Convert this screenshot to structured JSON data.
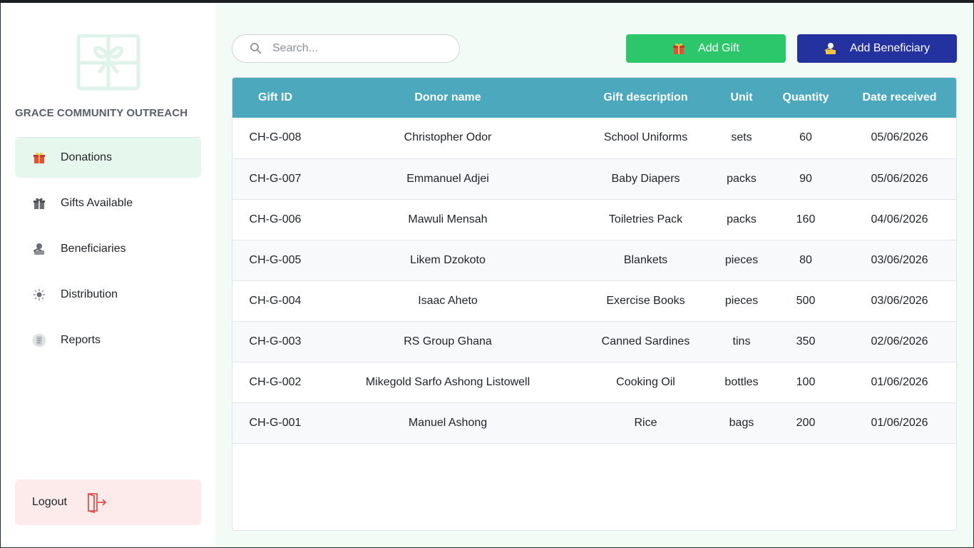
{
  "brand": {
    "name": "GRACE COMMUNITY OUTREACH",
    "logo_icon": "gift-box-logo-icon"
  },
  "sidebar": {
    "items": [
      {
        "label": "Donations",
        "icon": "gift-icon",
        "active": true
      },
      {
        "label": "Gifts Available",
        "icon": "gift-box-icon",
        "active": false
      },
      {
        "label": "Beneficiaries",
        "icon": "beneficiary-icon",
        "active": false
      },
      {
        "label": "Distribution",
        "icon": "distribution-icon",
        "active": false
      },
      {
        "label": "Reports",
        "icon": "report-icon",
        "active": false
      }
    ],
    "logout_label": "Logout"
  },
  "search": {
    "placeholder": "Search..."
  },
  "toolbar": {
    "add_gift_label": "Add Gift",
    "add_beneficiary_label": "Add Beneficiary"
  },
  "colors": {
    "active_nav_bg": "#e6f7ee",
    "add_gift_bg": "#2cc76a",
    "add_beneficiary_bg": "#2432a0",
    "table_header_bg": "#4ba8bd",
    "logout_bg": "#fdeaea",
    "main_bg": "#f3fbf6"
  },
  "table": {
    "headers": [
      "Gift ID",
      "Donor name",
      "Gift description",
      "Unit",
      "Quantity",
      "Date received"
    ],
    "rows": [
      [
        "CH-G-008",
        "Christopher Odor",
        "School Uniforms",
        "sets",
        "60",
        "05/06/2026"
      ],
      [
        "CH-G-007",
        "Emmanuel Adjei",
        "Baby Diapers",
        "packs",
        "90",
        "05/06/2026"
      ],
      [
        "CH-G-006",
        "Mawuli Mensah",
        "Toiletries Pack",
        "packs",
        "160",
        "04/06/2026"
      ],
      [
        "CH-G-005",
        "Likem Dzokoto",
        "Blankets",
        "pieces",
        "80",
        "03/06/2026"
      ],
      [
        "CH-G-004",
        "Isaac Aheto",
        "Exercise Books",
        "pieces",
        "500",
        "03/06/2026"
      ],
      [
        "CH-G-003",
        "RS Group Ghana",
        "Canned Sardines",
        "tins",
        "350",
        "02/06/2026"
      ],
      [
        "CH-G-002",
        "Mikegold Sarfo Ashong Listowell",
        "Cooking Oil",
        "bottles",
        "100",
        "01/06/2026"
      ],
      [
        "CH-G-001",
        "Manuel Ashong",
        "Rice",
        "bags",
        "200",
        "01/06/2026"
      ]
    ]
  }
}
